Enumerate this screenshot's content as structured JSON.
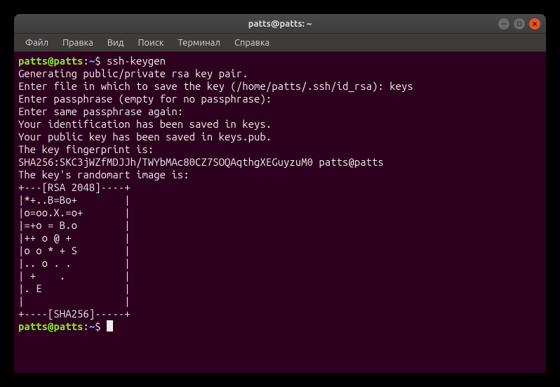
{
  "window": {
    "title": "patts@patts: ~"
  },
  "menu": {
    "items": [
      "Файл",
      "Правка",
      "Вид",
      "Поиск",
      "Терминал",
      "Справка"
    ]
  },
  "prompt": {
    "user_host": "patts@patts",
    "sep": ":",
    "path": "~",
    "symbol": "$"
  },
  "terminal": {
    "command": "ssh-keygen",
    "lines": [
      "Generating public/private rsa key pair.",
      "Enter file in which to save the key (/home/patts/.ssh/id_rsa): keys",
      "Enter passphrase (empty for no passphrase):",
      "Enter same passphrase again:",
      "Your identification has been saved in keys.",
      "Your public key has been saved in keys.pub.",
      "The key fingerprint is:",
      "SHA256:SKC3jWZfMDJJh/TWYbMAc80CZ7SOQAqthgXEGuyzuM0 patts@patts",
      "The key's randomart image is:",
      "+---[RSA 2048]----+",
      "|*+..B=Bo+        |",
      "|o=oo.X.=o+       |",
      "|=+o = B.o        |",
      "|++ o @ +         |",
      "|o o * + S        |",
      "|.. o . .         |",
      "| +    .          |",
      "|. E              |",
      "|                 |",
      "+----[SHA256]-----+"
    ]
  }
}
